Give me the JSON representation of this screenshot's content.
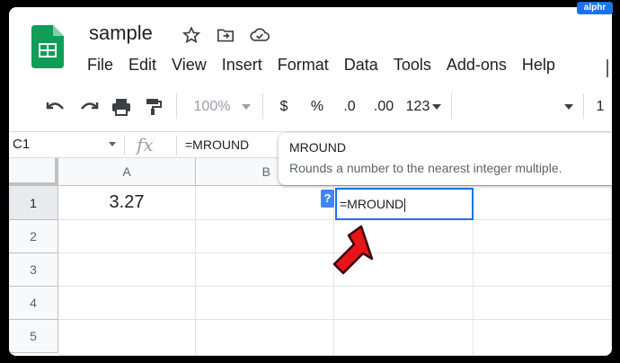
{
  "badge": "alphr",
  "doc": {
    "title": "sample"
  },
  "menu": [
    "File",
    "Edit",
    "View",
    "Insert",
    "Format",
    "Data",
    "Tools",
    "Add-ons",
    "Help"
  ],
  "toolbar": {
    "zoom": "100%",
    "currency": "$",
    "percent": "%",
    "decrease_decimal": ".0",
    "increase_decimal": ".00",
    "more_formats": "123",
    "font_size_partial": "1"
  },
  "formula_bar": {
    "name_box": "C1",
    "fx": "fx",
    "formula": "=MROUND"
  },
  "tooltip": {
    "title": "MROUND",
    "description": "Rounds a number to the nearest integer multiple."
  },
  "columns": [
    "A",
    "B"
  ],
  "rows": [
    "1",
    "2",
    "3",
    "4",
    "5"
  ],
  "cells": {
    "A1": "3.27",
    "C1": "=MROUND"
  },
  "help_chip": "?",
  "colors": {
    "accent": "#1a73e8",
    "arrow": "#e8141c",
    "sheets_green": "#0f9d58"
  }
}
